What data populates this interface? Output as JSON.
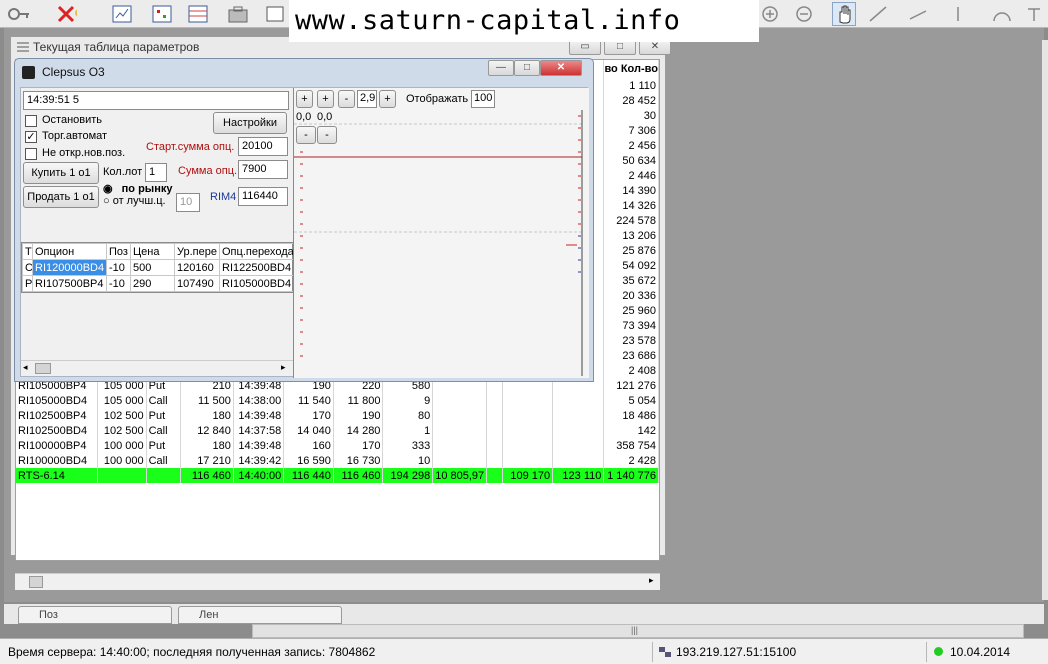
{
  "watermark": "www.saturn-capital.info",
  "param_window": {
    "title": "Текущая таблица параметров",
    "headers": {
      "col15": "во",
      "col16": "Кол-во"
    },
    "right_values": [
      "1 110",
      "28 452",
      "30",
      "7 306",
      "2 456",
      "50 634",
      "2 446",
      "14 390",
      "14 326",
      "224 578",
      "13 206",
      "25 876",
      "54 092",
      "35 672",
      "20 336",
      "25 960",
      "73 394",
      "23 578",
      "23 686",
      "2 408"
    ],
    "rows": [
      [
        "RI105000BP4",
        "105 000",
        "Put",
        "210",
        "14:39:48",
        "190",
        "220",
        "580",
        "",
        "",
        "",
        "",
        "121 276"
      ],
      [
        "RI105000BD4",
        "105 000",
        "Call",
        "11 500",
        "14:38:00",
        "11 540",
        "11 800",
        "9",
        "",
        "",
        "",
        "",
        "5 054"
      ],
      [
        "RI102500BP4",
        "102 500",
        "Put",
        "180",
        "14:39:48",
        "170",
        "190",
        "80",
        "",
        "",
        "",
        "",
        "18 486"
      ],
      [
        "RI102500BD4",
        "102 500",
        "Call",
        "12 840",
        "14:37:58",
        "14 040",
        "14 280",
        "1",
        "",
        "",
        "",
        "",
        "142"
      ],
      [
        "RI100000BP4",
        "100 000",
        "Put",
        "180",
        "14:39:48",
        "160",
        "170",
        "333",
        "",
        "",
        "",
        "",
        "358 754"
      ],
      [
        "RI100000BD4",
        "100 000",
        "Call",
        "17 210",
        "14:39:42",
        "16 590",
        "16 730",
        "10",
        "",
        "",
        "",
        "",
        "2 428"
      ],
      [
        "RTS-6.14",
        "",
        "",
        "116 460",
        "14:40:00",
        "116 440",
        "116 460",
        "194 298",
        "10 805,97",
        "",
        "109 170",
        "123 110",
        "1 140 776"
      ]
    ]
  },
  "clepsus": {
    "title": "Clepsus O3",
    "time_field": "14:39:51   5",
    "stop_label": "Остановить",
    "auto_label": "Торг.автомат",
    "no_new_label": "Не откр.нов.поз.",
    "settings_button": "Настройки",
    "start_sum_label": "Старт.сумма опц.",
    "start_sum_value": "20100",
    "opt_sum_label": "Сумма опц.",
    "opt_sum_value": "7900",
    "buy_button": "Купить 1 о1",
    "sell_button": "Продать 1 о1",
    "lot_label": "Кол.лот",
    "lot_value": "1",
    "market_label": "по рынку",
    "best_label": "от лучш.ц.",
    "best_value": "10",
    "fut_label": "RIM4",
    "fut_value": "116440",
    "ctrl": {
      "zoom_plus": "+",
      "zoom_minus": "-",
      "zoom_value": "2,9",
      "zoom_plus2": "+",
      "show_label": "Отображать",
      "show_value": "100",
      "coord_a": "0,0",
      "coord_b": "0,0",
      "btn_minus_a": "-",
      "btn_minus_b": "-",
      "sq_plus": "+"
    },
    "columns": [
      "Т",
      "Опцион",
      "Поз",
      "Цена",
      "Ур.пере",
      "Опц.перехода"
    ],
    "rows": [
      [
        "С",
        "RI120000BD4",
        "-10",
        "500",
        "120160",
        "RI122500BD4"
      ],
      [
        "Р",
        "RI107500BP4",
        "-10",
        "290",
        "107490",
        "RI105000BD4"
      ]
    ]
  },
  "tabs": [
    {
      "label": "Поз"
    },
    {
      "label": "Лен"
    }
  ],
  "status": {
    "server_time": "Время сервера: 14:40:00; последняя полученная запись: 7804862",
    "ip": "193.219.127.51:15100",
    "date": "10.04.2014"
  },
  "colors": {
    "highlight": "#19ff19",
    "selection": "#3a8ee6",
    "status_ok": "#22cc22"
  }
}
